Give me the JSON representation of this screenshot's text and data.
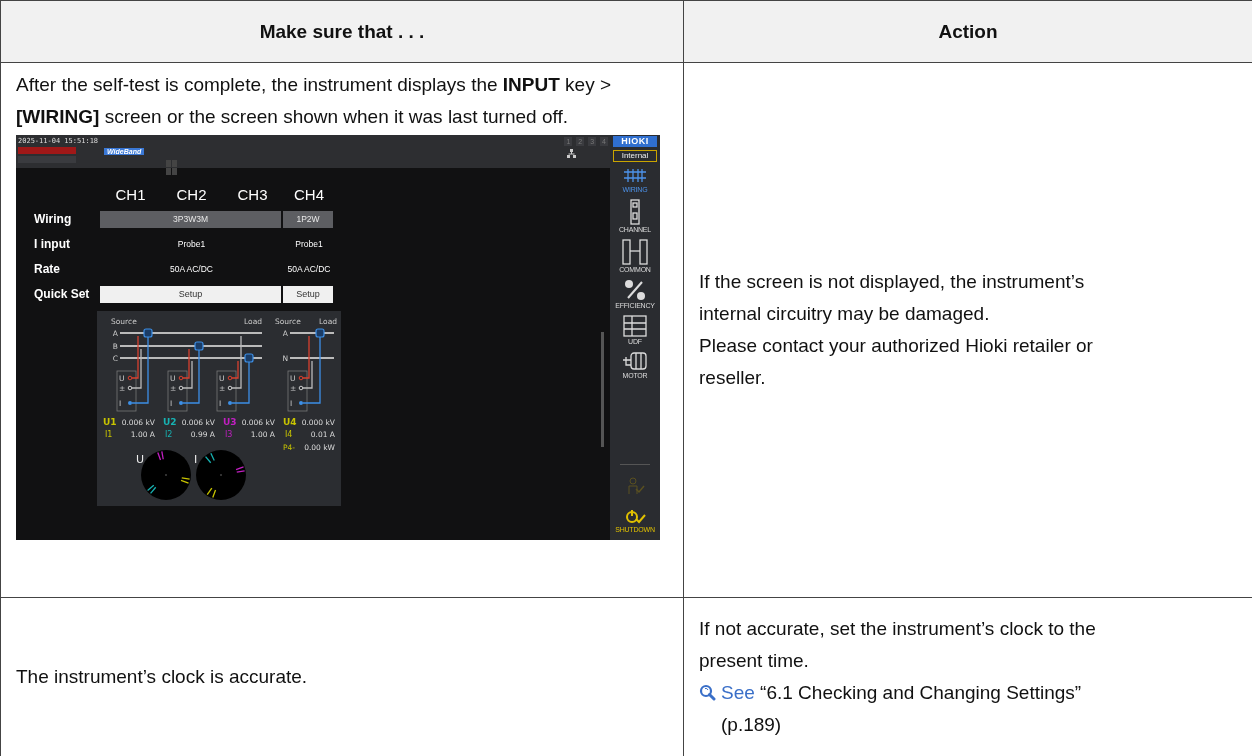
{
  "table": {
    "columns": [
      "Make sure that . . .",
      "Action"
    ],
    "rows": [
      {
        "check": "After the self-test is complete, the instrument displays the **INPUT** key > **[WIRING]** screen or the screen shown when it was last turned off.",
        "instrument_screen": {
          "datetime": "2025-11-04 15:51:18",
          "mode_badge": "WideBand",
          "channel_tabs": [
            "1",
            "2",
            "3",
            "4"
          ],
          "logo": "HIOKI",
          "source": "Internal",
          "channel_headers": [
            "CH1",
            "CH2",
            "CH3",
            "CH4"
          ],
          "settings": [
            {
              "label": "Wiring",
              "kind": "select",
              "values": [
                "3P3W3M",
                "1P2W"
              ]
            },
            {
              "label": "I input",
              "kind": "text",
              "values": [
                "Probe1",
                "Probe1"
              ]
            },
            {
              "label": "Rate",
              "kind": "text",
              "values": [
                "50A AC/DC",
                "50A AC/DC"
              ]
            },
            {
              "label": "Quick Set",
              "kind": "button",
              "values": [
                "Setup",
                "Setup"
              ]
            }
          ],
          "diagram": {
            "three_phase": {
              "source": "Source",
              "load": "Load",
              "lines": [
                "A",
                "B",
                "C"
              ]
            },
            "single_phase": {
              "source": "Source",
              "load": "Load",
              "lines": [
                "A",
                "N"
              ]
            },
            "terminal_labels": [
              [
                "U",
                "±",
                "I"
              ],
              [
                "U",
                "±",
                "I"
              ],
              [
                "U",
                "±",
                "I"
              ],
              [
                "U",
                "±",
                "I"
              ]
            ]
          },
          "readings": [
            {
              "color": "#c8c400",
              "u_label": "U1",
              "u_value": "0.006 kV",
              "i_label": "I1",
              "i_value": "1.00 A"
            },
            {
              "color": "#17b3b3",
              "u_label": "U2",
              "u_value": "0.006 kV",
              "i_label": "I2",
              "i_value": "0.99 A"
            },
            {
              "color": "#c21fc2",
              "u_label": "U3",
              "u_value": "0.006 kV",
              "i_label": "I3",
              "i_value": "1.00 A"
            },
            {
              "color": "#c8c400",
              "u_label": "U4",
              "u_value": "0.000 kV",
              "i_label": "I4",
              "i_value": "0.01 A",
              "p_label": "P4-",
              "p_value": "0.00 kW"
            }
          ],
          "phasors": [
            "U",
            "I"
          ],
          "menu": [
            {
              "kind": "wiring",
              "label": "WIRING",
              "selected": true
            },
            {
              "kind": "channel",
              "label": "CHANNEL",
              "selected": false
            },
            {
              "kind": "common",
              "label": "COMMON",
              "selected": false
            },
            {
              "kind": "efficiency",
              "label": "EFFICIENCY",
              "selected": false
            },
            {
              "kind": "udf",
              "label": "UDF",
              "selected": false
            },
            {
              "kind": "motor",
              "label": "MOTOR",
              "selected": false
            }
          ],
          "shutdown": "SHUTDOWN"
        },
        "action_lines": [
          "If the screen is not displayed, the instrument’s internal circuitry may be damaged.",
          "Please contact your authorized Hioki retailer or reseller."
        ]
      },
      {
        "check": "The instrument’s clock is accurate.",
        "action_lines": [
          "If not accurate, set the instrument’s clock to the present time."
        ],
        "reference": {
          "link": "See",
          "text": "“6.1 Checking and Changing Settings” (p.189)"
        }
      }
    ]
  }
}
